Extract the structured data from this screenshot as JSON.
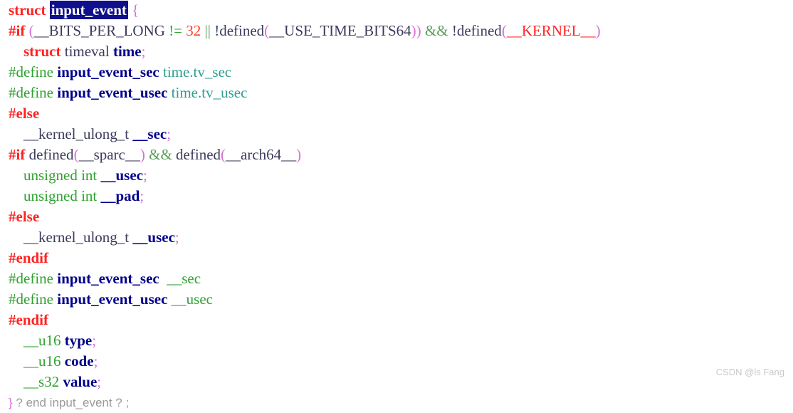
{
  "editor": {
    "background": "#ffffff",
    "selection_background": "#10108c",
    "selection_foreground": "#ffffff",
    "language": "C",
    "line_count": 18
  },
  "colors": {
    "preprocessor_conditional": "#ff2222",
    "preprocessor_define": "#2fa12f",
    "keyword": "#ff2222",
    "type": "#2fa12f",
    "identifier": "#3b3b5c",
    "member": "#00008b",
    "number": "#ff3b1f",
    "operator": "#2fa12f",
    "logical_operator": "#5aa05a",
    "bracket": "#d96fd9",
    "macro_argument": "#ff2222",
    "qualified_member": "#2f9e8f",
    "fold_placeholder": "#9a9a9a",
    "watermark": "#c9c9c9"
  },
  "selection": {
    "text": "input_event"
  },
  "watermark": {
    "text": "CSDN @ls Fang"
  },
  "lines": [
    {
      "n": 1,
      "indent": "",
      "text": "struct input_event {"
    },
    {
      "n": 2,
      "indent": "",
      "text": "#if (__BITS_PER_LONG != 32 || !defined(__USE_TIME_BITS64)) && !defined(__KERNEL__)"
    },
    {
      "n": 3,
      "indent": "    ",
      "text": "struct timeval time;"
    },
    {
      "n": 4,
      "indent": "",
      "text": "#define input_event_sec time.tv_sec"
    },
    {
      "n": 5,
      "indent": "",
      "text": "#define input_event_usec time.tv_usec"
    },
    {
      "n": 6,
      "indent": "",
      "text": "#else"
    },
    {
      "n": 7,
      "indent": "    ",
      "text": "__kernel_ulong_t __sec;"
    },
    {
      "n": 8,
      "indent": "",
      "text": "#if defined(__sparc__) && defined(__arch64__)"
    },
    {
      "n": 9,
      "indent": "    ",
      "text": "unsigned int __usec;"
    },
    {
      "n": 10,
      "indent": "    ",
      "text": "unsigned int __pad;"
    },
    {
      "n": 11,
      "indent": "",
      "text": "#else"
    },
    {
      "n": 12,
      "indent": "    ",
      "text": "__kernel_ulong_t __usec;"
    },
    {
      "n": 13,
      "indent": "",
      "text": "#endif"
    },
    {
      "n": 14,
      "indent": "",
      "text": "#define input_event_sec  __sec"
    },
    {
      "n": 15,
      "indent": "",
      "text": "#define input_event_usec __usec"
    },
    {
      "n": 16,
      "indent": "",
      "text": "#endif"
    },
    {
      "n": 17,
      "indent": "    ",
      "text": "__u16 type;"
    },
    {
      "n": 18,
      "indent": "    ",
      "text": "__u16 code;"
    },
    {
      "n": 19,
      "indent": "    ",
      "text": "__s32 value;"
    },
    {
      "n": 20,
      "indent": "",
      "text": "} ? end input_event ? ;"
    }
  ],
  "tokens": {
    "l1": {
      "kw": "struct",
      "sel": "input_event",
      "brace": "{"
    },
    "l2": {
      "pp": "#if",
      "p1": "(",
      "m1": "__BITS_PER_LONG",
      "op": "!=",
      "num": "32",
      "logic1": "||",
      "not1": "!defined",
      "p2": "(",
      "m2": "__USE_TIME_BITS64",
      "p3": ")",
      "p4": ")",
      "logic2": "&&",
      "not2": "!defined",
      "p5": "(",
      "m3": "__KERNEL__",
      "p6": ")"
    },
    "l3": {
      "kw": "struct",
      "type": "timeval",
      "name": "time",
      "semi": ";"
    },
    "l4": {
      "pp": "#define",
      "macro": "input_event_sec",
      "value": "time.tv_sec"
    },
    "l5": {
      "pp": "#define",
      "macro": "input_event_usec",
      "value": "time.tv_usec"
    },
    "l6": {
      "pp": "#else"
    },
    "l7": {
      "type": "__kernel_ulong_t",
      "name": "__sec",
      "semi": ";"
    },
    "l8": {
      "pp": "#if",
      "d1": "defined",
      "p1": "(",
      "m1": "__sparc__",
      "p2": ")",
      "logic": "&&",
      "d2": "defined",
      "p3": "(",
      "m2": "__arch64__",
      "p4": ")"
    },
    "l9": {
      "type": "unsigned int",
      "name": "__usec",
      "semi": ";"
    },
    "l10": {
      "type": "unsigned int",
      "name": "__pad",
      "semi": ";"
    },
    "l11": {
      "pp": "#else"
    },
    "l12": {
      "type": "__kernel_ulong_t",
      "name": "__usec",
      "semi": ";"
    },
    "l13": {
      "pp": "#endif"
    },
    "l14": {
      "pp": "#define",
      "macro": "input_event_sec",
      "value": "__sec"
    },
    "l15": {
      "pp": "#define",
      "macro": "input_event_usec",
      "value": "__usec"
    },
    "l16": {
      "pp": "#endif"
    },
    "l17": {
      "type": "__u16",
      "name": "type",
      "semi": ";"
    },
    "l18": {
      "type": "__u16",
      "name": "code",
      "semi": ";"
    },
    "l19": {
      "type": "__s32",
      "name": "value",
      "semi": ";"
    },
    "l20": {
      "brace": "}",
      "fold": " ? end input_event ? ;"
    }
  }
}
